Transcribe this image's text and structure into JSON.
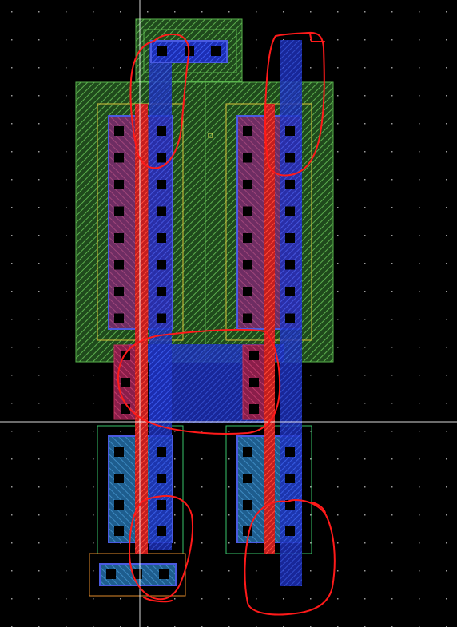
{
  "app": {
    "view": "layout-editor-canvas",
    "description_visible_text": []
  },
  "colors": {
    "background": "#000000",
    "grid_dot": "#9a9a9a",
    "crosshair": "#ffffff",
    "nwell_fill": "#2f6b2a",
    "nwell_stroke": "#59b34d",
    "active_stroke": "#39c46a",
    "pselect_stroke": "#d8c23a",
    "nselect_stroke": "#e08a2a",
    "poly": "#ff2a2a",
    "poly_dark": "#b81e1e",
    "diffusion_p": "#8a3a66",
    "diffusion_n": "#2a6aa8",
    "metal1": "#2a3bd8",
    "metal1_light": "#4a8ad8",
    "contact": "#000000",
    "annotation_red": "#ff1a1a",
    "marker": "#e8e85a"
  },
  "layout": {
    "layers": [
      "nwell",
      "pselect",
      "nselect",
      "active",
      "poly",
      "metal1",
      "contact"
    ],
    "transistors": [
      {
        "name": "pmos-left",
        "type": "pmos"
      },
      {
        "name": "pmos-right",
        "type": "pmos"
      },
      {
        "name": "nmos-left",
        "type": "nmos"
      },
      {
        "name": "nmos-right",
        "type": "nmos"
      }
    ]
  },
  "annotations": {
    "type": "freehand-red-loops",
    "count": 5
  }
}
